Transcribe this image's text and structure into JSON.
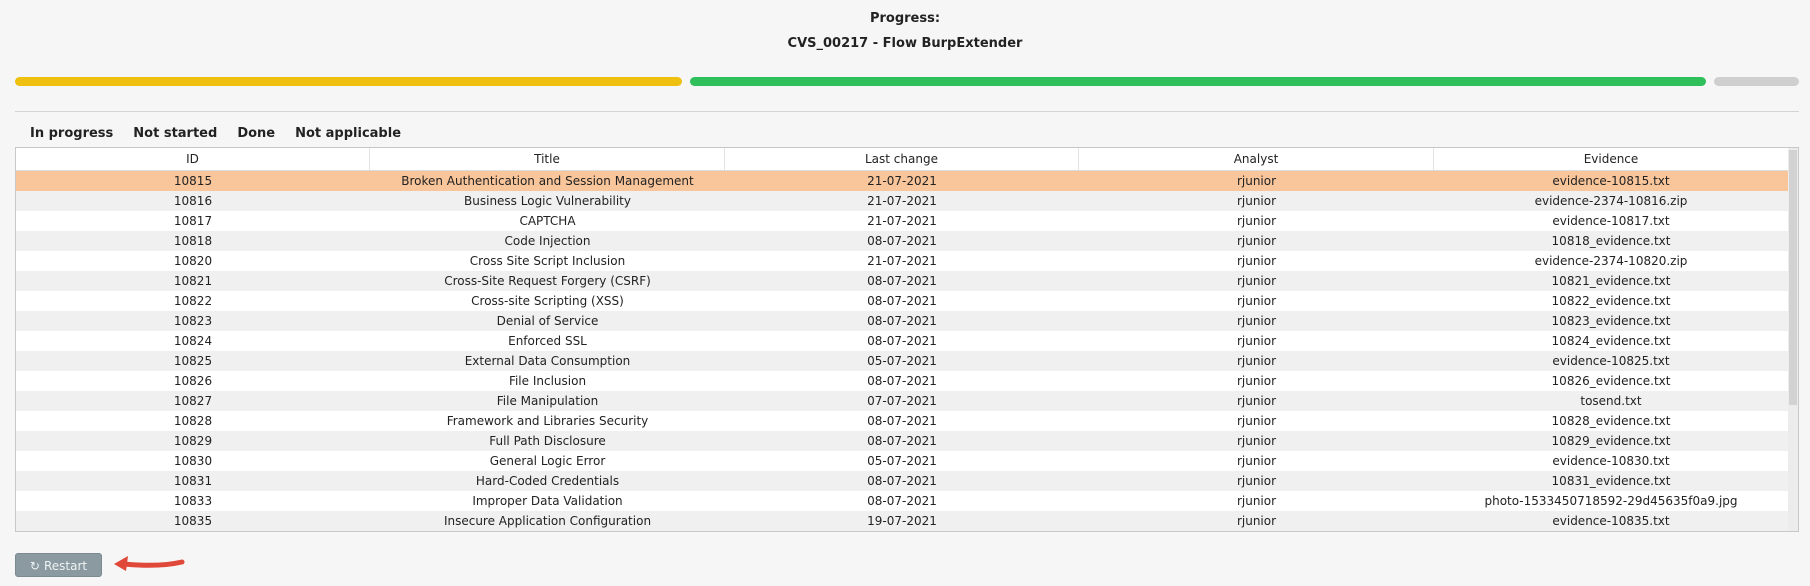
{
  "header": {
    "label": "Progress:",
    "flow_title": "CVS_00217 - Flow BurpExtender"
  },
  "progress": {
    "segments": [
      {
        "name": "yellow",
        "color": "#f0c010"
      },
      {
        "name": "green",
        "color": "#2fbf5b"
      },
      {
        "name": "gray",
        "color": "#cfcfcf"
      }
    ]
  },
  "tabs": [
    {
      "label": "In progress"
    },
    {
      "label": "Not started"
    },
    {
      "label": "Done"
    },
    {
      "label": "Not applicable"
    }
  ],
  "table": {
    "headers": {
      "id": "ID",
      "title": "Title",
      "last_change": "Last change",
      "analyst": "Analyst",
      "evidence": "Evidence"
    },
    "rows": [
      {
        "id": "10815",
        "title": "Broken Authentication and Session Management",
        "date": "21-07-2021",
        "analyst": "rjunior",
        "evidence": "evidence-10815.txt"
      },
      {
        "id": "10816",
        "title": "Business Logic Vulnerability",
        "date": "21-07-2021",
        "analyst": "rjunior",
        "evidence": "evidence-2374-10816.zip"
      },
      {
        "id": "10817",
        "title": "CAPTCHA",
        "date": "21-07-2021",
        "analyst": "rjunior",
        "evidence": "evidence-10817.txt"
      },
      {
        "id": "10818",
        "title": "Code Injection",
        "date": "08-07-2021",
        "analyst": "rjunior",
        "evidence": "10818_evidence.txt"
      },
      {
        "id": "10820",
        "title": "Cross Site Script Inclusion",
        "date": "21-07-2021",
        "analyst": "rjunior",
        "evidence": "evidence-2374-10820.zip"
      },
      {
        "id": "10821",
        "title": "Cross-Site Request Forgery (CSRF)",
        "date": "08-07-2021",
        "analyst": "rjunior",
        "evidence": "10821_evidence.txt"
      },
      {
        "id": "10822",
        "title": "Cross-site Scripting (XSS)",
        "date": "08-07-2021",
        "analyst": "rjunior",
        "evidence": "10822_evidence.txt"
      },
      {
        "id": "10823",
        "title": "Denial of Service",
        "date": "08-07-2021",
        "analyst": "rjunior",
        "evidence": "10823_evidence.txt"
      },
      {
        "id": "10824",
        "title": "Enforced SSL",
        "date": "08-07-2021",
        "analyst": "rjunior",
        "evidence": "10824_evidence.txt"
      },
      {
        "id": "10825",
        "title": "External Data Consumption",
        "date": "05-07-2021",
        "analyst": "rjunior",
        "evidence": "evidence-10825.txt"
      },
      {
        "id": "10826",
        "title": "File Inclusion",
        "date": "08-07-2021",
        "analyst": "rjunior",
        "evidence": "10826_evidence.txt"
      },
      {
        "id": "10827",
        "title": "File Manipulation",
        "date": "07-07-2021",
        "analyst": "rjunior",
        "evidence": "tosend.txt"
      },
      {
        "id": "10828",
        "title": "Framework and Libraries Security",
        "date": "08-07-2021",
        "analyst": "rjunior",
        "evidence": "10828_evidence.txt"
      },
      {
        "id": "10829",
        "title": "Full Path Disclosure",
        "date": "08-07-2021",
        "analyst": "rjunior",
        "evidence": "10829_evidence.txt"
      },
      {
        "id": "10830",
        "title": "General Logic Error",
        "date": "05-07-2021",
        "analyst": "rjunior",
        "evidence": "evidence-10830.txt"
      },
      {
        "id": "10831",
        "title": "Hard-Coded Credentials",
        "date": "08-07-2021",
        "analyst": "rjunior",
        "evidence": "10831_evidence.txt"
      },
      {
        "id": "10833",
        "title": "Improper Data Validation",
        "date": "08-07-2021",
        "analyst": "rjunior",
        "evidence": "photo-1533450718592-29d45635f0a9.jpg"
      },
      {
        "id": "10835",
        "title": "Insecure Application Configuration",
        "date": "19-07-2021",
        "analyst": "rjunior",
        "evidence": "evidence-10835.txt"
      }
    ]
  },
  "footer": {
    "restart_label": "Restart",
    "restart_icon": "refresh-icon"
  },
  "colors": {
    "selected_row": "#f9c59a",
    "active_tab_underline": "#e8703a",
    "annotation_arrow": "#e0483a"
  }
}
